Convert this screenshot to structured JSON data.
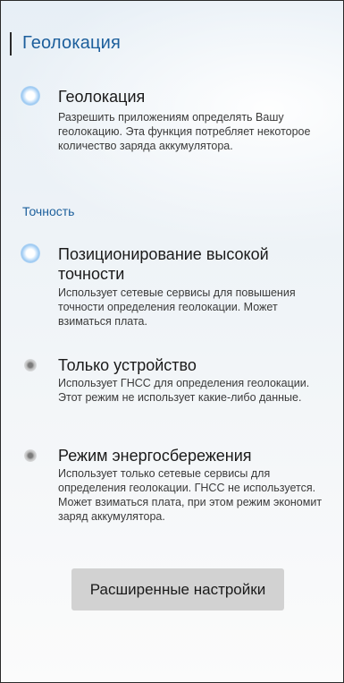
{
  "header": {
    "title": "Геолокация"
  },
  "geolocation": {
    "title": "Геолокация",
    "description": "Разрешить приложениям определять Вашу геолокацию. Эта функция потребляет некоторое количество заряда аккумулятора.",
    "enabled": true
  },
  "accuracy": {
    "section_label": "Точность",
    "options": [
      {
        "title": "Позиционирование высокой точности",
        "description": "Использует сетевые сервисы для повышения точности определения геолокации. Может взиматься плата.",
        "selected": true
      },
      {
        "title": "Только устройство",
        "description": "Использует ГНСС для определения геолокации. Этот режим не использует какие-либо данные.",
        "selected": false
      },
      {
        "title": "Режим энергосбережения",
        "description": "Использует только сетевые сервисы для определения геолокации. ГНСС не используется. Может взиматься плата, при этом режим экономит заряд аккумулятора.",
        "selected": false
      }
    ]
  },
  "advanced_button": {
    "label": "Расширенные настройки"
  }
}
